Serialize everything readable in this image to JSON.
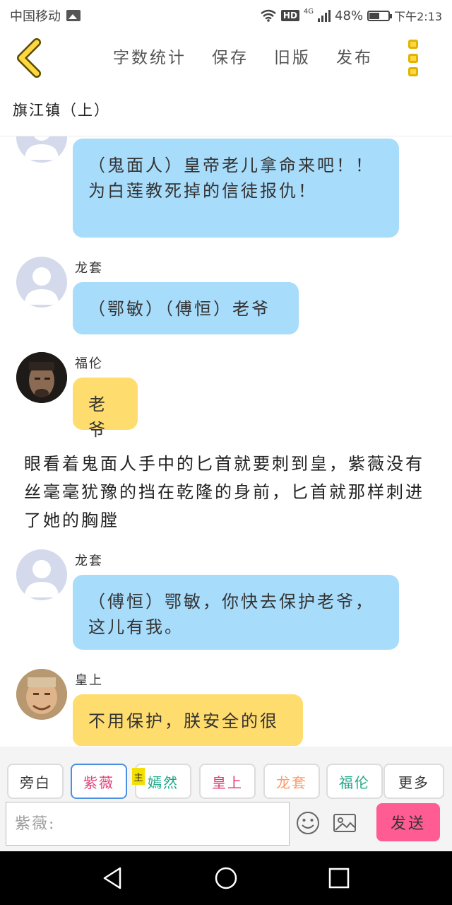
{
  "status_bar": {
    "carrier": "中国移动",
    "hd": "HD",
    "network": "4G",
    "battery": "48%",
    "time": "下午2:13"
  },
  "header": {
    "toolbar": [
      "字数统计",
      "保存",
      "旧版",
      "发布"
    ]
  },
  "document": {
    "title": "旗江镇（上）"
  },
  "messages": [
    {
      "type": "bubble",
      "speaker": "",
      "text": "（鬼面人）皇帝老儿拿命来吧！！为白莲教死掉的信徒报仇！",
      "color": "blue"
    },
    {
      "type": "bubble",
      "speaker": "龙套",
      "text": "（鄂敏）（傅恒）老爷",
      "color": "blue"
    },
    {
      "type": "bubble",
      "speaker": "福伦",
      "text": "老爷",
      "color": "yellow"
    },
    {
      "type": "narration",
      "text": "眼看着鬼面人手中的匕首就要刺到皇，紫薇没有丝毫毫犹豫的挡在乾隆的身前，匕首就那样刺进了她的胸膛"
    },
    {
      "type": "bubble",
      "speaker": "龙套",
      "text": "（傅恒）鄂敏，你快去保护老爷，这儿有我。",
      "color": "blue"
    },
    {
      "type": "bubble",
      "speaker": "皇上",
      "text": "不用保护，朕安全的很",
      "color": "yellow"
    }
  ],
  "roles": [
    {
      "label": "旁白",
      "color": "#333333",
      "active": false
    },
    {
      "label": "紫薇",
      "color": "#e0407a",
      "active": true
    },
    {
      "label": "嫣然",
      "color": "#1fa888",
      "active": false
    },
    {
      "label": "皇上",
      "color": "#e0407a",
      "active": false
    },
    {
      "label": "龙套",
      "color": "#ff9c6b",
      "active": false
    },
    {
      "label": "福伦",
      "color": "#1fa888",
      "active": false
    },
    {
      "label": "更多",
      "color": "#333333",
      "active": false
    }
  ],
  "main_tag": "主",
  "input": {
    "placeholder": "紫薇:"
  },
  "send_label": "发送",
  "colors": {
    "blue_bubble": "#a8dcfb",
    "yellow_bubble": "#ffdc6e",
    "send_button": "#ff5c93",
    "menu_icon": "#ffd740"
  }
}
